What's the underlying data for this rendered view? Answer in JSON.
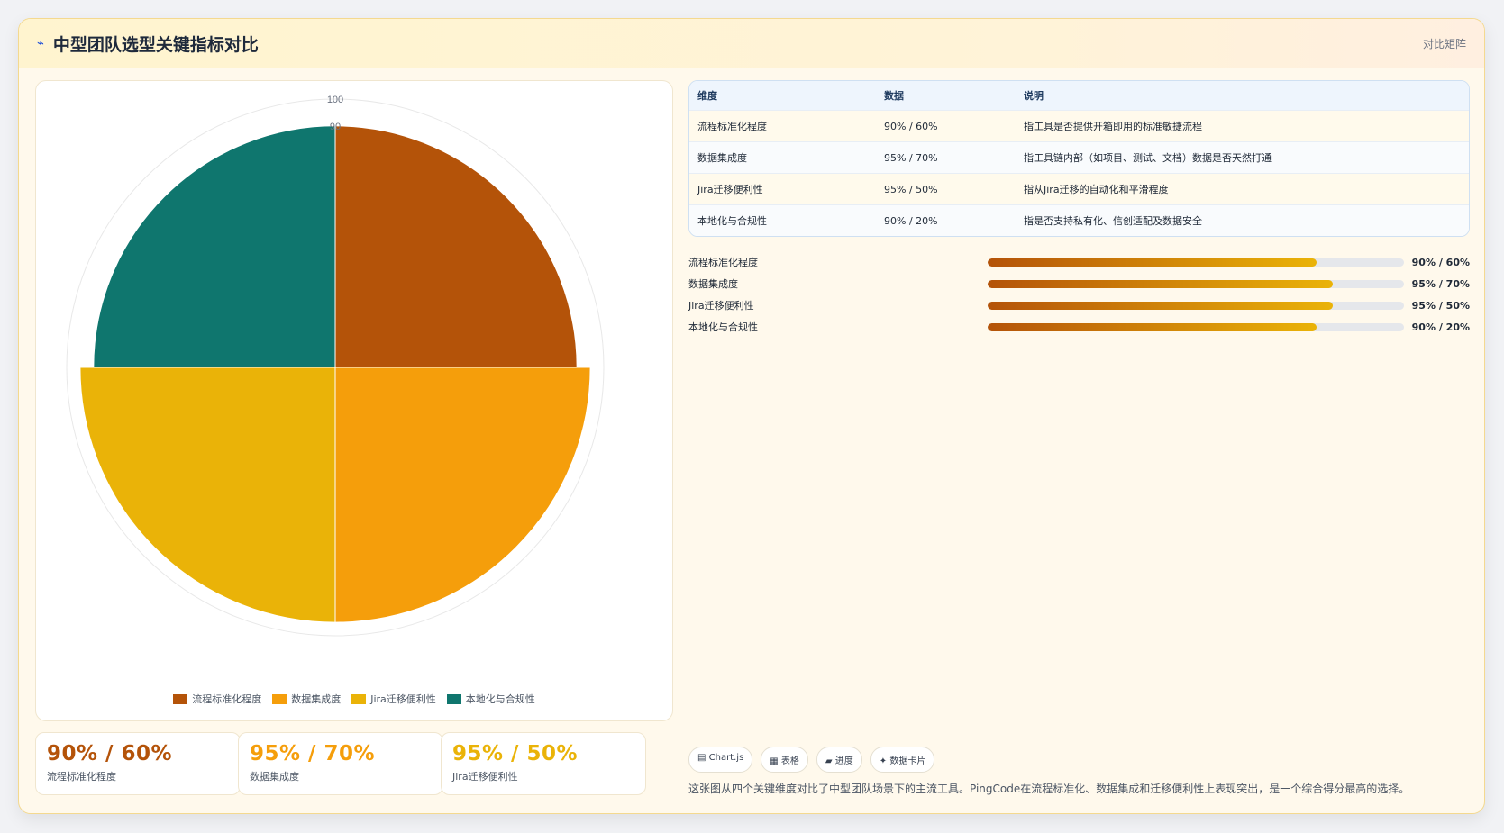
{
  "header": {
    "icon": "chart-line-icon",
    "title": "中型团队选型关键指标对比",
    "tag": "对比矩阵"
  },
  "colors": {
    "series": [
      "#b45309",
      "#f59e0b",
      "#eab308",
      "#0f766e"
    ]
  },
  "chart_data": {
    "type": "polarArea",
    "categories": [
      "流程标准化程度",
      "数据集成度",
      "Jira迁移便利性",
      "本地化与合规性"
    ],
    "values": [
      90,
      95,
      95,
      90
    ],
    "rlim": [
      0,
      100
    ],
    "ticks": [
      "100",
      "90"
    ],
    "legend_position": "bottom"
  },
  "stats": [
    {
      "value": "90% / 60%",
      "label": "流程标准化程度",
      "color": "#b45309"
    },
    {
      "value": "95% / 70%",
      "label": "数据集成度",
      "color": "#f59e0b"
    },
    {
      "value": "95% / 50%",
      "label": "Jira迁移便利性",
      "color": "#eab308"
    }
  ],
  "table": {
    "headers": [
      "维度",
      "数据",
      "说明"
    ],
    "rows": [
      [
        "流程标准化程度",
        "90% / 60%",
        "指工具是否提供开箱即用的标准敏捷流程"
      ],
      [
        "数据集成度",
        "95% / 70%",
        "指工具链内部（如项目、测试、文档）数据是否天然打通"
      ],
      [
        "Jira迁移便利性",
        "95% / 50%",
        "指从Jira迁移的自动化和平滑程度"
      ],
      [
        "本地化与合规性",
        "90% / 20%",
        "指是否支持私有化、信创适配及数据安全"
      ]
    ]
  },
  "progress": [
    {
      "label": "流程标准化程度",
      "value": "90% / 60%",
      "fraction": 0.79
    },
    {
      "label": "数据集成度",
      "value": "95% / 70%",
      "fraction": 0.83
    },
    {
      "label": "Jira迁移便利性",
      "value": "95% / 50%",
      "fraction": 0.83
    },
    {
      "label": "本地化与合规性",
      "value": "90% / 20%",
      "fraction": 0.79
    }
  ],
  "chips": [
    "▤ Chart.js",
    "▦ 表格",
    "▰ 进度",
    "✦ 数据卡片"
  ],
  "summary": "这张图从四个关键维度对比了中型团队场景下的主流工具。PingCode在流程标准化、数据集成和迁移便利性上表现突出，是一个综合得分最高的选择。"
}
